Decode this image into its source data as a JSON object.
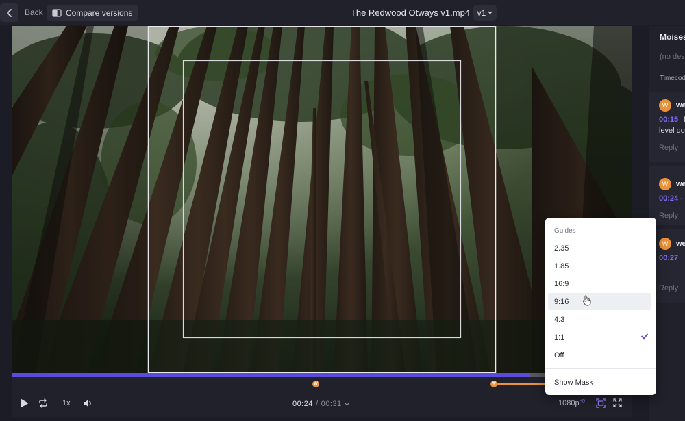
{
  "topbar": {
    "back_label": "Back",
    "compare_label": "Compare versions",
    "file_title": "The Redwood Otways v1.mp4",
    "version_label": "v1"
  },
  "timeline": {
    "progress_fraction": 0.835,
    "markers": [
      {
        "label": "W",
        "time": "00:15"
      },
      {
        "label": "W",
        "time": "00:24"
      }
    ]
  },
  "controls": {
    "speed_label": "1x",
    "current_time": "00:24",
    "separator": "/",
    "duration": "00:31",
    "quality_label": "1080p",
    "quality_badge": "HD"
  },
  "panel": {
    "title": "Moises",
    "description": "(no des",
    "timecode_header": "Timecod",
    "comments": [
      {
        "avatar": "W",
        "user": "we",
        "time": "00:15",
        "text": "N",
        "text2": "level do",
        "reply": "Reply"
      },
      {
        "avatar": "W",
        "user": "we",
        "time": "00:24 -",
        "text": "",
        "text2": "",
        "reply": "Reply"
      },
      {
        "avatar": "W",
        "user": "we",
        "time": "00:27",
        "text": "",
        "text2": "",
        "reply": "Reply"
      }
    ]
  },
  "guides_menu": {
    "heading": "Guides",
    "items": [
      "2.35",
      "1.85",
      "16:9",
      "9:16",
      "4:3",
      "1:1",
      "Off"
    ],
    "hovered_item": "9:16",
    "selected_item": "1:1",
    "show_mask_label": "Show Mask"
  },
  "colors": {
    "accent": "#5b4bdb",
    "marker": "#e8923a",
    "panel_bg": "#20212b"
  }
}
